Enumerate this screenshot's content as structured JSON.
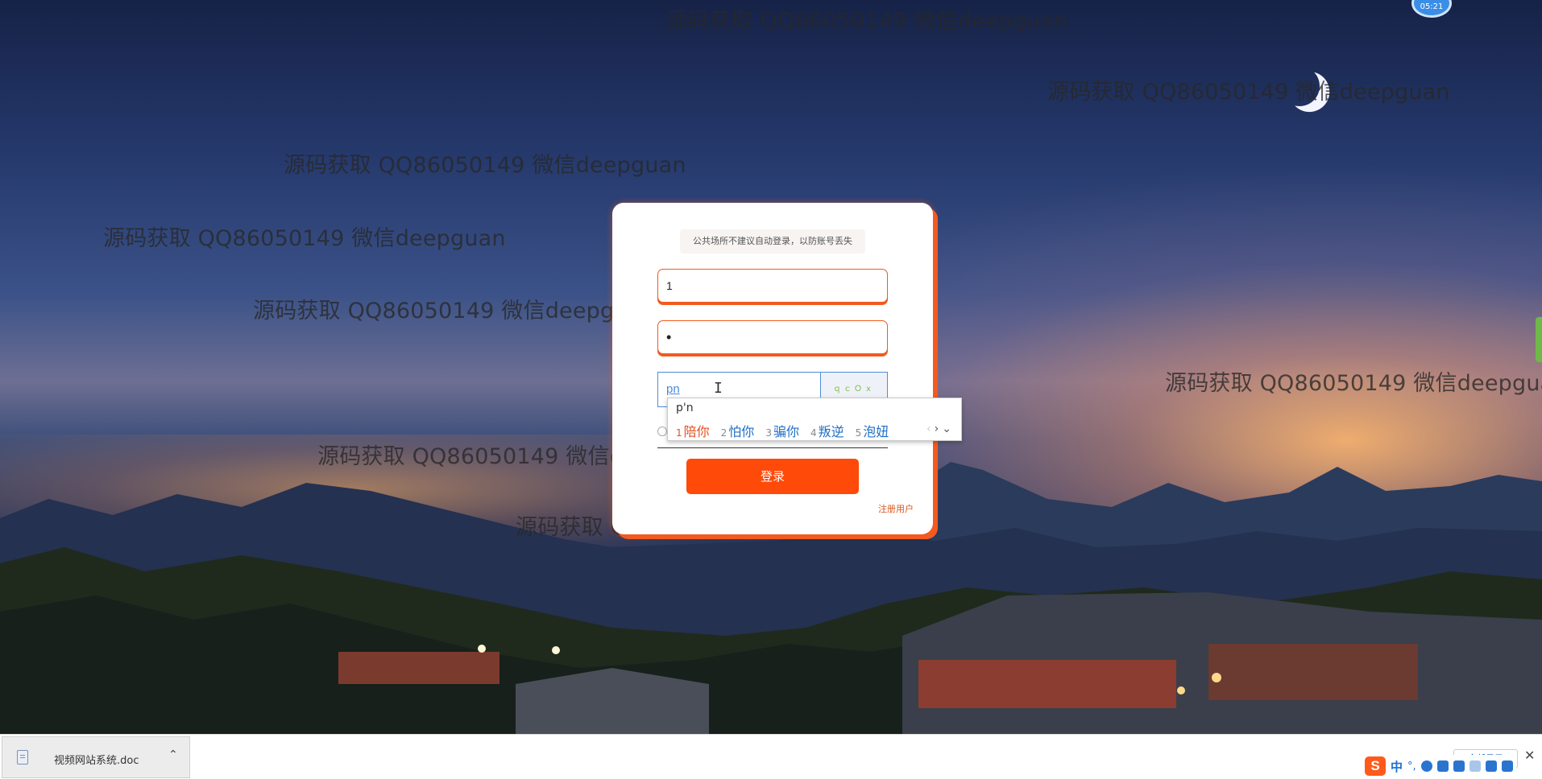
{
  "watermark_text": "源码获取 QQ86050149 微信deepguan",
  "timer_badge": "05:21",
  "login": {
    "notice": "公共场所不建议自动登录，以防账号丢失",
    "username_value": "1",
    "password_value": "•",
    "captcha_input_value": "pn",
    "captcha_image_text": "ｑｃＯｘ",
    "login_button": "登录",
    "register_link": "注册用户"
  },
  "ime_popup": {
    "composition": "p'n",
    "candidates": [
      {
        "num": "1",
        "word": "陪你"
      },
      {
        "num": "2",
        "word": "怕你"
      },
      {
        "num": "3",
        "word": "骗你"
      },
      {
        "num": "4",
        "word": "叛逆"
      },
      {
        "num": "5",
        "word": "泡妞"
      }
    ],
    "nav_prev": "‹",
    "nav_next": "›",
    "nav_more": "⌄"
  },
  "download_bar": {
    "file_name": "视频网站系统.doc",
    "expand_icon": "chevron-up-icon",
    "show_all": "全部显示",
    "close": "✕"
  },
  "ime_status": {
    "logo": "S",
    "mode": "中",
    "punct": "°,"
  },
  "colors": {
    "accent": "#f25a1f",
    "login_button": "#ff4a0a",
    "captcha_border": "#4d8fd6"
  }
}
